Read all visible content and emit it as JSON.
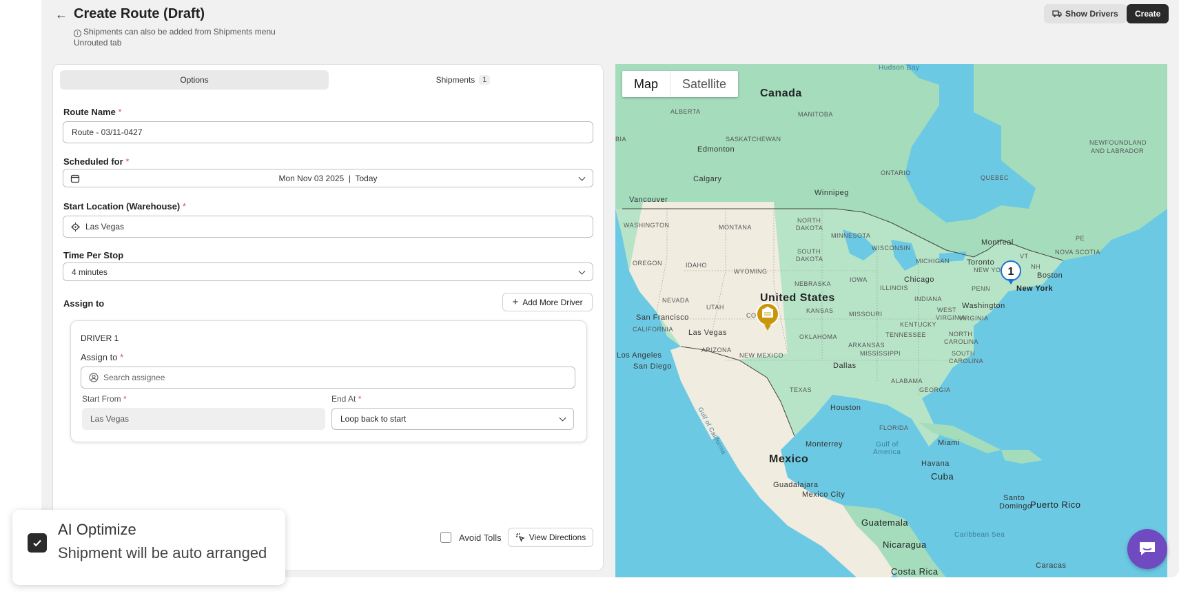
{
  "header": {
    "back_icon": "arrow-left-icon",
    "title": "Create Route (Draft)",
    "note": "Shipments can also be added from Shipments menu Unrouted tab",
    "show_drivers": "Show Drivers",
    "create": "Create"
  },
  "tabs": [
    {
      "label": "Options",
      "active": true
    },
    {
      "label": "Shipments",
      "count": "1"
    }
  ],
  "form": {
    "route_name_label": "Route Name",
    "route_name_value": "Route - 03/11-0427",
    "scheduled_label": "Scheduled for",
    "scheduled_value": "Mon Nov 03 2025  |  Today",
    "start_location_label": "Start Location (Warehouse)",
    "start_location_value": "Las Vegas",
    "time_per_stop_label": "Time Per Stop",
    "time_per_stop_value": "4 minutes",
    "assign_to_label": "Assign to",
    "add_more_driver": "Add More Driver",
    "required_mark": "*"
  },
  "driver": {
    "heading": "DRIVER 1",
    "assign_to_label": "Assign to",
    "search_placeholder": "Search assignee",
    "start_from_label": "Start From",
    "start_from_value": "Las Vegas",
    "end_at_label": "End At",
    "end_at_value": "Loop back to start"
  },
  "footer": {
    "avoid_tolls": "Avoid Tolls",
    "avoid_tolls_checked": false,
    "view_directions": "View Directions"
  },
  "ai_optimize": {
    "title": "AI Optimize",
    "subtitle": "Shipment will be auto arranged",
    "checked": true
  },
  "map": {
    "mode_map": "Map",
    "mode_satellite": "Satellite",
    "active_mode": "Map",
    "marker_number": "1",
    "labels": {
      "hudson_bay": "Hudson Bay",
      "canada": "Canada",
      "alberta": "ALBERTA",
      "manitoba": "MANITOBA",
      "saskatchewan": "SASKATCHEWAN",
      "bia": "BIA",
      "edmonton": "Edmonton",
      "calgary": "Calgary",
      "ontario": "ONTARIO",
      "quebec": "QUEBEC",
      "newfoundland": "NEWFOUNDLAND",
      "and_labrador": "AND LABRADOR",
      "winnipeg": "Winnipeg",
      "vancouver": "Vancouver",
      "washington": "WASHINGTON",
      "montana": "MONTANA",
      "north_dakota_1": "NORTH",
      "north_dakota_2": "DAKOTA",
      "minnesota": "MINNESOTA",
      "south_dakota_1": "SOUTH",
      "south_dakota_2": "DAKOTA",
      "oregon": "OREGON",
      "idaho": "IDAHO",
      "wyoming": "WYOMING",
      "wisconsin": "WISCONSIN",
      "michigan": "MICHIGAN",
      "montreal": "Montreal",
      "toronto": "Toronto",
      "new_york_state": "NEW YO",
      "pe": "PE",
      "nova_scotia": "NOVA SCOTIA",
      "vt": "VT",
      "nh": "NH",
      "boston": "Boston",
      "new_york": "New York",
      "chicago": "Chicago",
      "iowa": "IOWA",
      "nebraska": "NEBRASKA",
      "penn": "PENN",
      "illinois": "ILLINOIS",
      "indiana": "INDIANA",
      "nevada": "NEVADA",
      "utah": "UTAH",
      "united_states": "United States",
      "colorado": "CO",
      "kansas": "KANSAS",
      "missouri": "MISSOURI",
      "washington_dc": "Washington",
      "west_virginia_1": "WEST",
      "west_virginia_2": "VIRGINIA",
      "virginia": "VIRGINIA",
      "kentucky": "KENTUCKY",
      "san_francisco": "San Francisco",
      "california": "CALIFORNIA",
      "las_vegas": "Las Vegas",
      "tennessee": "TENNESSEE",
      "north_carolina_1": "NORTH",
      "north_carolina_2": "CAROLINA",
      "oklahoma": "OKLAHOMA",
      "arkansas": "ARKANSAS",
      "arizona": "ARIZONA",
      "los_angeles": "Los Angeles",
      "new_mexico": "NEW MEXICO",
      "mississippi": "MISSISSIPPI",
      "south_carolina_1": "SOUTH",
      "south_carolina_2": "CAROLINA",
      "san_diego": "San Diego",
      "dallas": "Dallas",
      "alabama": "ALABAMA",
      "georgia": "GEORGIA",
      "texas": "TEXAS",
      "houston": "Houston",
      "gulf_of_california": "Gulf of California",
      "florida": "FLORIDA",
      "monterrey": "Monterrey",
      "gulf_of_america_1": "Gulf of",
      "gulf_of_america_2": "America",
      "miami": "Miami",
      "mexico": "Mexico",
      "havana": "Havana",
      "cuba": "Cuba",
      "guadalajara": "Guadalajara",
      "mexico_city": "Mexico City",
      "santo_domingo_1": "Santo",
      "santo_domingo_2": "Domingo",
      "puerto_rico": "Puerto Rico",
      "guatemala": "Guatemala",
      "caribbean_sea": "Caribbean Sea",
      "nicaragua": "Nicaragua",
      "caracas": "Caracas",
      "costa_rica": "Costa Rica"
    }
  },
  "colors": {
    "accent_dark": "#2a2a2a",
    "warehouse_marker": "#c9950a",
    "stop_marker": "#1e6fd9",
    "chat_bubble": "#6f4ac0",
    "water": "#6cc9e3",
    "land": "#a8dfc0"
  }
}
